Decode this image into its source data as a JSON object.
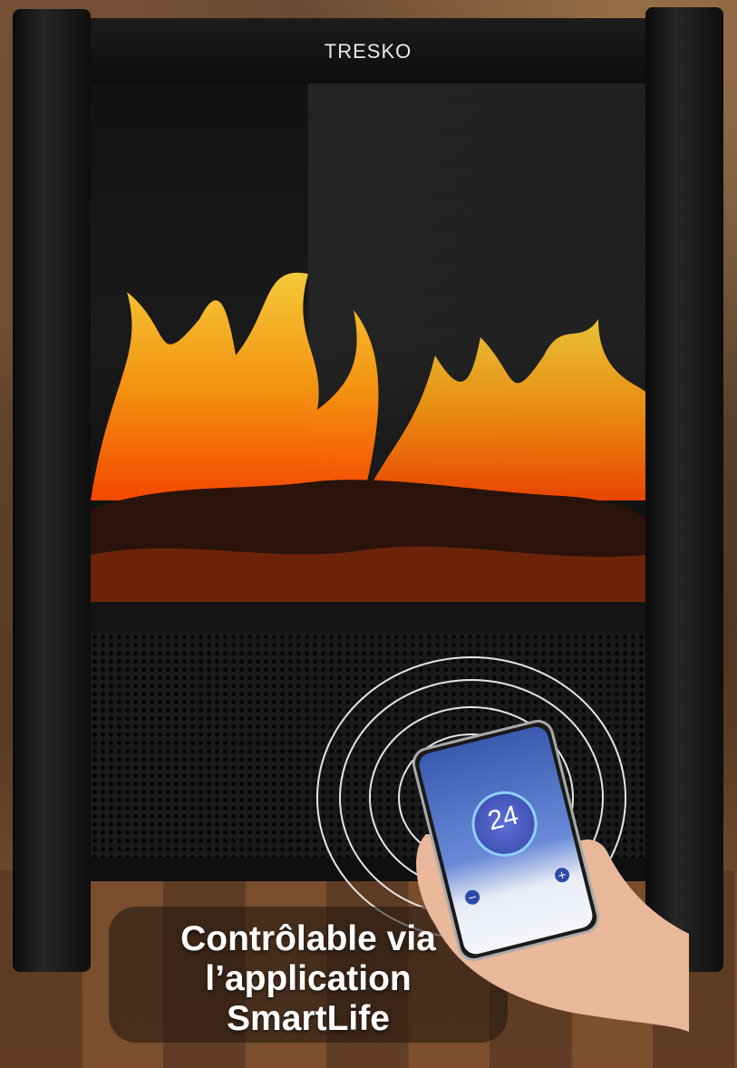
{
  "brand": {
    "name": "TRESKO"
  },
  "caption": {
    "lines": [
      "Contrôlable via",
      "l’application",
      "SmartLife"
    ]
  },
  "app": {
    "temperature": "24",
    "minus_symbol": "−",
    "plus_symbol": "+"
  },
  "colors": {
    "flame_orange": "#f28a1a",
    "flame_yellow": "#ffd23a",
    "frame": "#111111"
  },
  "icons": [
    "wifi-signal-icon"
  ]
}
